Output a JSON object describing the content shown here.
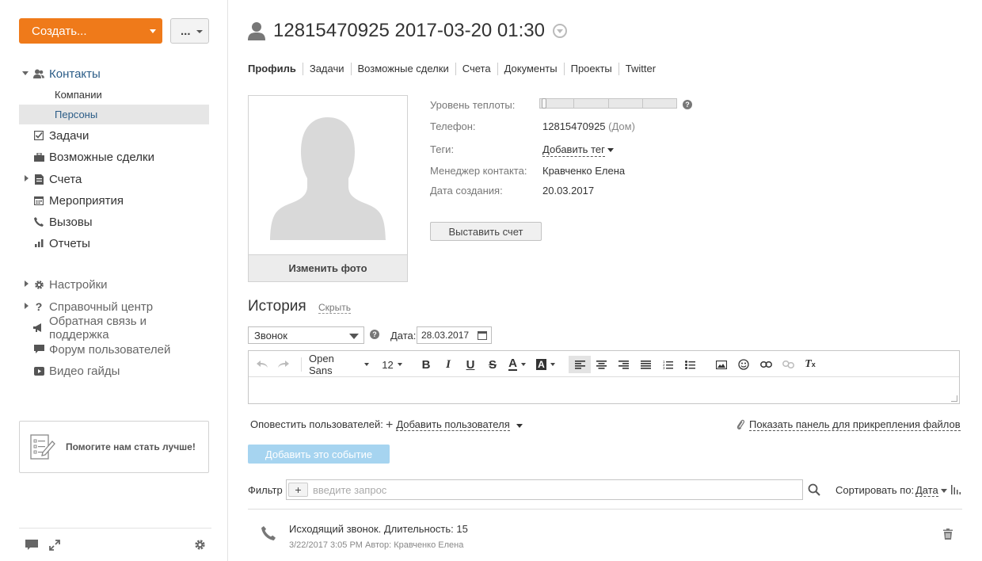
{
  "sidebar": {
    "create_label": "Создать...",
    "more_label": "...",
    "items": [
      {
        "label": "Контакты",
        "icon": "contacts-icon"
      },
      {
        "label": "Компании"
      },
      {
        "label": "Персоны"
      },
      {
        "label": "Задачи",
        "icon": "tasks-icon"
      },
      {
        "label": "Возможные сделки",
        "icon": "deals-icon"
      },
      {
        "label": "Счета",
        "icon": "invoice-icon"
      },
      {
        "label": "Мероприятия",
        "icon": "calendar-icon"
      },
      {
        "label": "Вызовы",
        "icon": "phone-icon"
      },
      {
        "label": "Отчеты",
        "icon": "reports-icon"
      },
      {
        "label": "Настройки",
        "icon": "gear-icon"
      },
      {
        "label": "Справочный центр",
        "icon": "question-icon"
      },
      {
        "label": "Обратная связь и поддержка",
        "icon": "megaphone-icon"
      },
      {
        "label": "Форум пользователей",
        "icon": "chat-icon"
      },
      {
        "label": "Видео гайды",
        "icon": "video-icon"
      }
    ],
    "help_box": "Помогите нам стать лучше!"
  },
  "header": {
    "title": "12815470925 2017-03-20 01:30"
  },
  "tabs": [
    "Профиль",
    "Задачи",
    "Возможные сделки",
    "Счета",
    "Документы",
    "Проекты",
    "Twitter"
  ],
  "profile": {
    "change_photo": "Изменить фото",
    "heat_label": "Уровень теплоты:",
    "heat_level": 0,
    "phone_label": "Телефон:",
    "phone_value": "12815470925",
    "phone_type": "(Дом)",
    "tags_label": "Теги:",
    "tags_link": "Добавить тег",
    "manager_label": "Менеджер контакта:",
    "manager_value": "Кравченко Елена",
    "created_label": "Дата создания:",
    "created_value": "20.03.2017",
    "invoice_button": "Выставить счет"
  },
  "history": {
    "title": "История",
    "hide": "Скрыть",
    "event_type": "Звонок",
    "date_label": "Дата:",
    "date_value": "28.03.2017",
    "toolbar": {
      "font": "Open Sans",
      "size": "12"
    },
    "notify_label": "Оповестить пользователей:",
    "notify_add": "Добавить пользователя",
    "attach_link": "Показать панель для прикрепления файлов",
    "add_event_button": "Добавить это событие",
    "filter_label": "Фильтр",
    "filter_placeholder": "введите запрос",
    "sort_label": "Сортировать по:",
    "sort_value": "Дата",
    "events": [
      {
        "title": "Исходящий звонок. Длительность: 15",
        "meta": "3/22/2017 3:05 PM Автор: Кравченко Елена"
      }
    ]
  },
  "colors": {
    "accent": "#ef7a1a",
    "link": "#2b5c87",
    "add_event_bg": "#a6d4f0"
  }
}
